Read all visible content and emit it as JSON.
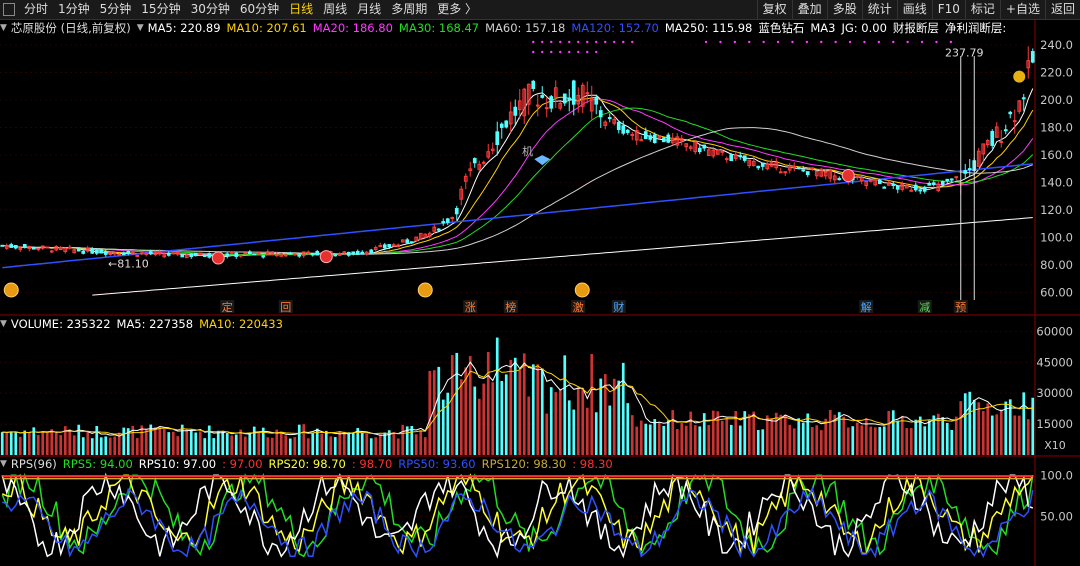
{
  "toolbar": {
    "left": [
      "分时",
      "1分钟",
      "5分钟",
      "15分钟",
      "30分钟",
      "60分钟",
      "日线",
      "周线",
      "月线",
      "多周期",
      "更多 〉"
    ],
    "active": "日线",
    "right": [
      "复权",
      "叠加",
      "多股",
      "统计",
      "画线",
      "F10",
      "标记",
      "+自选",
      "返回"
    ]
  },
  "price_info": {
    "title": "芯原股份 (日线,前复权)",
    "items": [
      {
        "label": "MA5: 220.89",
        "color": "#ffffff"
      },
      {
        "label": "MA10: 207.61",
        "color": "#ffd200"
      },
      {
        "label": "MA20: 186.80",
        "color": "#ff39ff"
      },
      {
        "label": "MA30: 168.47",
        "color": "#22dd22"
      },
      {
        "label": "MA60: 157.18",
        "color": "#d0d0d0"
      },
      {
        "label": "MA120: 152.70",
        "color": "#3050ff"
      },
      {
        "label": "MA250: 115.98",
        "color": "#ffffff"
      },
      {
        "label": "蓝色钻石",
        "color": "#ffffff"
      },
      {
        "label": "MA3",
        "color": "#ffffff"
      },
      {
        "label": "JG: 0.00",
        "color": "#ffffff"
      },
      {
        "label": "财报断层",
        "color": "#ffffff"
      },
      {
        "label": "净利润断层:",
        "color": "#ffffff"
      }
    ]
  },
  "vol_info": {
    "items": [
      {
        "label": "VOLUME: 235322",
        "color": "#ffffff"
      },
      {
        "label": "MA5: 227358",
        "color": "#ffffff"
      },
      {
        "label": "MA10: 220433",
        "color": "#ffd200"
      }
    ]
  },
  "rps_info": {
    "items": [
      {
        "label": "RPS(96)",
        "color": "#dddddd"
      },
      {
        "label": "RPS5: 94.00",
        "color": "#22dd22"
      },
      {
        "label": "RPS10: 97.00",
        "color": "#ffffff"
      },
      {
        "label": ": 97.00",
        "color": "#ff3030"
      },
      {
        "label": "RPS20: 98.70",
        "color": "#ffff30"
      },
      {
        "label": ": 98.70",
        "color": "#ff3030"
      },
      {
        "label": "RPS50: 93.60",
        "color": "#3050ff"
      },
      {
        "label": "RPS120: 98.30",
        "color": "#c8a832"
      },
      {
        "label": ": 98.30",
        "color": "#ff3030"
      }
    ]
  },
  "price_axis": {
    "ticks": [
      "240.0",
      "220.0",
      "200.0",
      "180.0",
      "160.0",
      "140.0",
      "120.0",
      "100.0",
      "80.00",
      "60.00"
    ],
    "values": [
      240,
      220,
      200,
      180,
      160,
      140,
      120,
      100,
      80,
      60
    ]
  },
  "vol_axis": {
    "ticks": [
      "60000",
      "45000",
      "30000",
      "15000"
    ],
    "values": [
      60000,
      45000,
      30000,
      15000
    ],
    "unit": "X10"
  },
  "rps_axis": {
    "ticks": [
      "100.0",
      "50.00"
    ],
    "values": [
      100,
      50
    ]
  },
  "annotations": {
    "high": "237.79",
    "low": "81.10",
    "ji": "机",
    "event_labels": [
      {
        "text": "定",
        "idx": 50,
        "color": "#ff7a30"
      },
      {
        "text": "回",
        "idx": 63,
        "color": "#ff7a30"
      },
      {
        "text": "涨",
        "idx": 104,
        "color": "#ff7a30"
      },
      {
        "text": "榜",
        "idx": 113,
        "color": "#ff7a30"
      },
      {
        "text": "激",
        "idx": 128,
        "color": "#ff7a30"
      },
      {
        "text": "财",
        "idx": 137,
        "color": "#4aa8ff"
      },
      {
        "text": "解",
        "idx": 192,
        "color": "#4aa8ff"
      },
      {
        "text": "减",
        "idx": 205,
        "color": "#55dd55"
      },
      {
        "text": "预",
        "idx": 213,
        "color": "#ff7a30"
      }
    ]
  },
  "colors": {
    "up": "#ff3b3b",
    "down": "#54ffff",
    "grid": "#3a0000",
    "bg": "#000000"
  }
}
